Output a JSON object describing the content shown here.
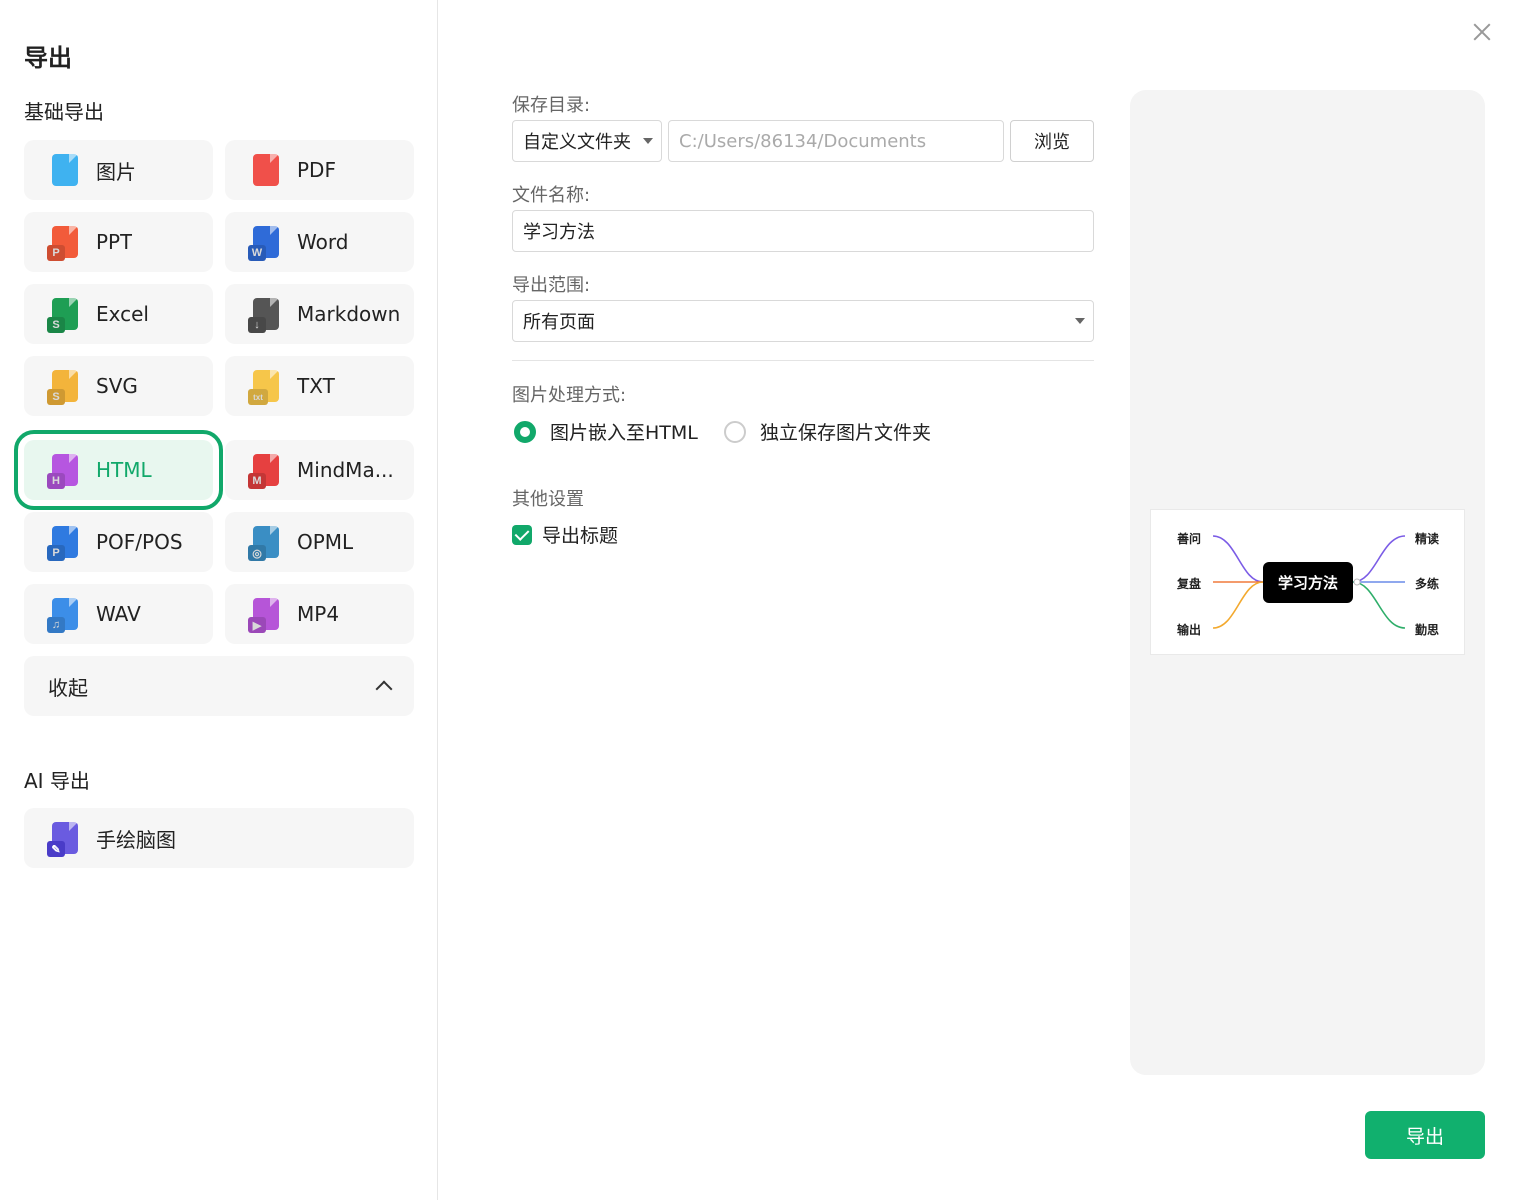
{
  "dialog": {
    "title": "导出",
    "close_icon": "close-icon"
  },
  "sidebar": {
    "basic_section_title": "基础导出",
    "formats": [
      {
        "label": "图片",
        "icon": "image-file-icon",
        "color": "#3fb2f0",
        "badge": ""
      },
      {
        "label": "PDF",
        "icon": "pdf-file-icon",
        "color": "#f0504a",
        "badge": ""
      },
      {
        "label": "PPT",
        "icon": "ppt-file-icon",
        "color": "#f25b3a",
        "badge": "P"
      },
      {
        "label": "Word",
        "icon": "word-file-icon",
        "color": "#2f6bd8",
        "badge": "W"
      },
      {
        "label": "Excel",
        "icon": "excel-file-icon",
        "color": "#1e9e54",
        "badge": "S"
      },
      {
        "label": "Markdown",
        "icon": "markdown-file-icon",
        "color": "#555555",
        "badge": "↓"
      },
      {
        "label": "SVG",
        "icon": "svg-file-icon",
        "color": "#f3b43b",
        "badge": "S"
      },
      {
        "label": "TXT",
        "icon": "txt-file-icon",
        "color": "#f6c64a",
        "badge": "txt"
      },
      {
        "label": "HTML",
        "icon": "html-file-icon",
        "color": "#b656e0",
        "badge": "H",
        "selected": true
      },
      {
        "label": "MindMa...",
        "icon": "mindmanager-file-icon",
        "color": "#e64040",
        "badge": "M"
      },
      {
        "label": "POF/POS",
        "icon": "pof-file-icon",
        "color": "#2f7ae0",
        "badge": "P"
      },
      {
        "label": "OPML",
        "icon": "opml-file-icon",
        "color": "#3a8ec4",
        "badge": "◎"
      },
      {
        "label": "WAV",
        "icon": "wav-file-icon",
        "color": "#3c8ee8",
        "badge": "♫"
      },
      {
        "label": "MP4",
        "icon": "mp4-file-icon",
        "color": "#b655d8",
        "badge": "▶"
      }
    ],
    "collapse_label": "收起",
    "ai_section_title": "AI 导出",
    "ai_items": [
      {
        "label": "手绘脑图",
        "icon": "hand-drawn-mindmap-icon",
        "color": "#6a5be0"
      }
    ]
  },
  "form": {
    "save_dir_label": "保存目录:",
    "save_dir_select": "自定义文件夹",
    "save_dir_path_placeholder": "C:/Users/86134/Documents",
    "browse_label": "浏览",
    "filename_label": "文件名称:",
    "filename_value": "学习方法",
    "range_label": "导出范围:",
    "range_value": "所有页面",
    "image_mode_label": "图片处理方式:",
    "image_mode_options": [
      {
        "label": "图片嵌入至HTML",
        "checked": true
      },
      {
        "label": "独立保存图片文件夹",
        "checked": false
      }
    ],
    "other_settings_label": "其他设置",
    "export_title_label": "导出标题",
    "export_title_checked": true
  },
  "preview": {
    "root": "学习方法",
    "left_nodes": [
      "善问",
      "复盘",
      "输出"
    ],
    "right_nodes": [
      "精读",
      "多练",
      "勤思"
    ],
    "branch_colors": {
      "purple": "#7b5ce6",
      "orange": "#f07a3c",
      "amber": "#f3a92e",
      "blue": "#6a8ce8",
      "green": "#2fae6a"
    }
  },
  "footer": {
    "export_label": "导出"
  },
  "colors": {
    "accent": "#11a86a",
    "selected_bg": "#e8f7ef",
    "button_bg": "#f6f6f6"
  }
}
